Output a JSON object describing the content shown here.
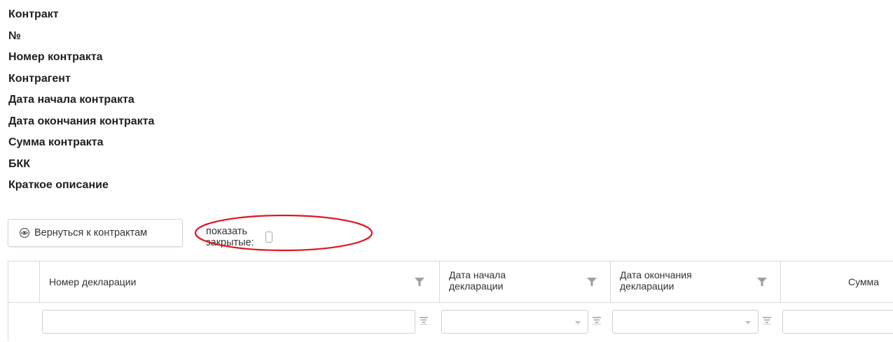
{
  "contract": {
    "fields": [
      "Контракт",
      "№",
      "Номер контракта",
      "Контрагент",
      "Дата начала контракта",
      "Дата окончания контракта",
      "Сумма контракта",
      "БКК",
      "Краткое описание"
    ]
  },
  "toolbar": {
    "back_label": "Вернуться к контрактам",
    "show_closed_label": "показать закрытые:",
    "show_closed_checked": false,
    "highlight_color": "#e0161f"
  },
  "grid": {
    "columns": [
      {
        "label": "Номер декларации"
      },
      {
        "label_line1": "Дата начала",
        "label_line2": "декларации"
      },
      {
        "label_line1": "Дата окончания",
        "label_line2": "декларации"
      },
      {
        "label": "Сумма"
      }
    ],
    "filters": {
      "number_value": "",
      "start_date_value": "",
      "end_date_value": "",
      "amount_value": ""
    },
    "icons": [
      "filter-funnel-icon",
      "filter-lines-icon",
      "chevron-down-icon",
      "eye-icon"
    ],
    "border_color": "#d9d9d9",
    "icon_color": "#9e9e9e"
  }
}
